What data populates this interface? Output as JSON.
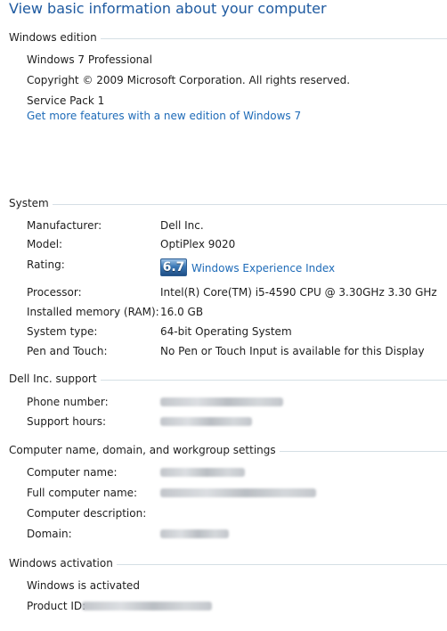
{
  "page": {
    "title": "View basic information about your computer"
  },
  "windows_edition": {
    "header": "Windows edition",
    "edition": "Windows 7 Professional",
    "copyright": "Copyright © 2009 Microsoft Corporation.  All rights reserved.",
    "service_pack": "Service Pack 1",
    "upgrade_link": "Get more features with a new edition of Windows 7"
  },
  "system": {
    "header": "System",
    "manufacturer_label": "Manufacturer:",
    "manufacturer_value": "Dell Inc.",
    "model_label": "Model:",
    "model_value": "OptiPlex 9020",
    "rating_label": "Rating:",
    "rating_score": "6.7",
    "rating_link": "Windows Experience Index",
    "processor_label": "Processor:",
    "processor_value": "Intel(R) Core(TM) i5-4590 CPU @ 3.30GHz   3.30 GHz",
    "memory_label": "Installed memory (RAM):",
    "memory_value": "16.0 GB",
    "system_type_label": "System type:",
    "system_type_value": "64-bit Operating System",
    "pen_touch_label": "Pen and Touch:",
    "pen_touch_value": "No Pen or Touch Input is available for this Display"
  },
  "support": {
    "header": "Dell Inc. support",
    "phone_label": "Phone number:",
    "hours_label": "Support hours:"
  },
  "computer_name": {
    "header": "Computer name, domain, and workgroup settings",
    "name_label": "Computer name:",
    "full_name_label": "Full computer name:",
    "description_label": "Computer description:",
    "domain_label": "Domain:"
  },
  "activation": {
    "header": "Windows activation",
    "status": "Windows is activated",
    "product_id_label": "Product ID:"
  },
  "colors": {
    "title_blue": "#1e5aa0",
    "link_blue": "#1e6bb8",
    "separator": "#d5dfe5",
    "badge_blue": "#3a78b6"
  }
}
